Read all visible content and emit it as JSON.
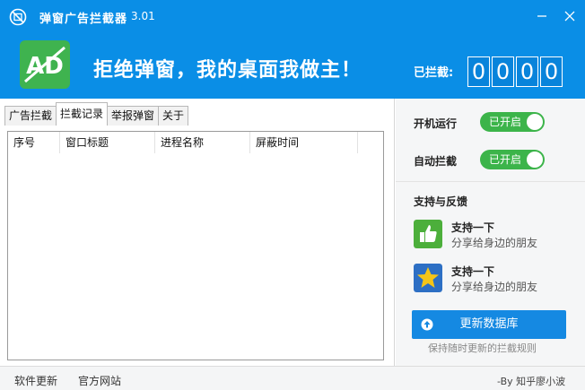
{
  "titlebar": {
    "title": "弹窗广告拦截器",
    "version": "3.01"
  },
  "banner": {
    "logo_text": "AD",
    "slogan": "拒绝弹窗，我的桌面我做主！",
    "blocked_label": "已拦截:",
    "blocked_digits": [
      "0",
      "0",
      "0",
      "0"
    ]
  },
  "tabs": [
    {
      "label": "广告拦截",
      "active": false
    },
    {
      "label": "拦截记录",
      "active": true
    },
    {
      "label": "举报弹窗",
      "active": false
    },
    {
      "label": "关于",
      "active": false
    }
  ],
  "table": {
    "columns": [
      "序号",
      "窗口标题",
      "进程名称",
      "屏蔽时间"
    ],
    "rows": []
  },
  "settings": {
    "startup_label": "开机运行",
    "startup_state": "已开启",
    "auto_block_label": "自动拦截",
    "auto_block_state": "已开启"
  },
  "support": {
    "title": "支持与反馈",
    "items": [
      {
        "title": "支持一下",
        "desc": "分享给身边的朋友",
        "icon": "thumbs-up-icon"
      },
      {
        "title": "支持一下",
        "desc": "分享给身边的朋友",
        "icon": "star-icon"
      }
    ],
    "update_button": "更新数据库",
    "update_hint": "保持随时更新的拦截规则"
  },
  "footer": {
    "software_update": "软件更新",
    "official_site": "官方网站",
    "credit": "-By 知乎廖小波"
  },
  "colors": {
    "primary": "#0a8ee6",
    "toggle_on": "#3cb44a",
    "logo_green": "#3fb34f",
    "button_blue": "#1589e2"
  }
}
